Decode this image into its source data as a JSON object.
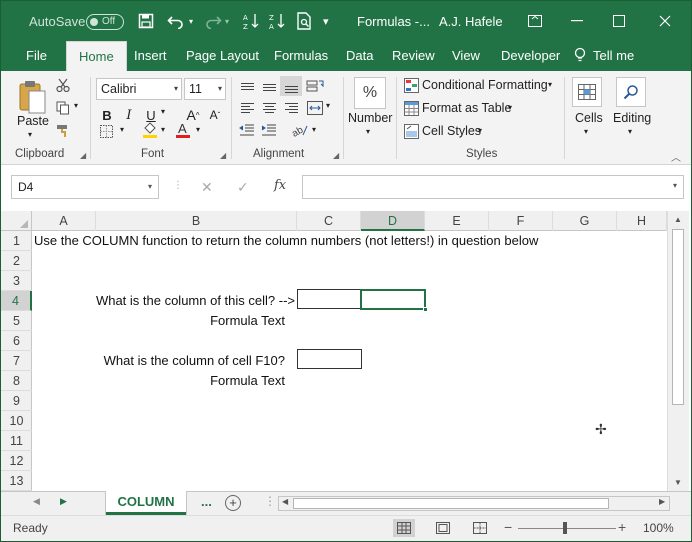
{
  "titlebar": {
    "autosave_label": "AutoSave",
    "autosave_state": "Off",
    "doc_title": "Formulas -...",
    "user_name": "A.J. Hafele"
  },
  "tabs": [
    {
      "label": "File"
    },
    {
      "label": "Home"
    },
    {
      "label": "Insert"
    },
    {
      "label": "Page Layout"
    },
    {
      "label": "Formulas"
    },
    {
      "label": "Data"
    },
    {
      "label": "Review"
    },
    {
      "label": "View"
    },
    {
      "label": "Developer"
    },
    {
      "label": "Tell me"
    }
  ],
  "active_tab": "Home",
  "ribbon": {
    "clipboard": {
      "paste_label": "Paste",
      "group_label": "Clipboard"
    },
    "font": {
      "font_name": "Calibri",
      "font_size": "11",
      "group_label": "Font"
    },
    "alignment": {
      "group_label": "Alignment"
    },
    "number": {
      "symbol": "%",
      "label": "Number"
    },
    "styles": {
      "conditional_formatting": "Conditional Formatting",
      "format_as_table": "Format as Table",
      "cell_styles": "Cell Styles",
      "group_label": "Styles"
    },
    "cells": {
      "label": "Cells"
    },
    "editing": {
      "label": "Editing"
    }
  },
  "formula_bar": {
    "name_box": "D4",
    "fx_label": "fx",
    "formula": ""
  },
  "grid": {
    "columns": [
      "A",
      "B",
      "C",
      "D",
      "E",
      "F",
      "G",
      "H"
    ],
    "rows": [
      "1",
      "2",
      "3",
      "4",
      "5",
      "6",
      "7",
      "8",
      "9",
      "10",
      "11",
      "12",
      "13"
    ],
    "selected_column": "D",
    "selected_row": "4",
    "cells": {
      "a1": "Use the COLUMN function to return the column numbers (not letters!) in question below",
      "b4": "What is the column of this cell? -->",
      "b5": "Formula Text",
      "b7": "What is the column of cell F10?",
      "b8": "Formula Text"
    }
  },
  "sheets": {
    "active": "COLUMN",
    "more_label": "...",
    "add_label": "+"
  },
  "statusbar": {
    "status": "Ready",
    "zoom": "100%"
  },
  "colors": {
    "accent": "#217346"
  }
}
